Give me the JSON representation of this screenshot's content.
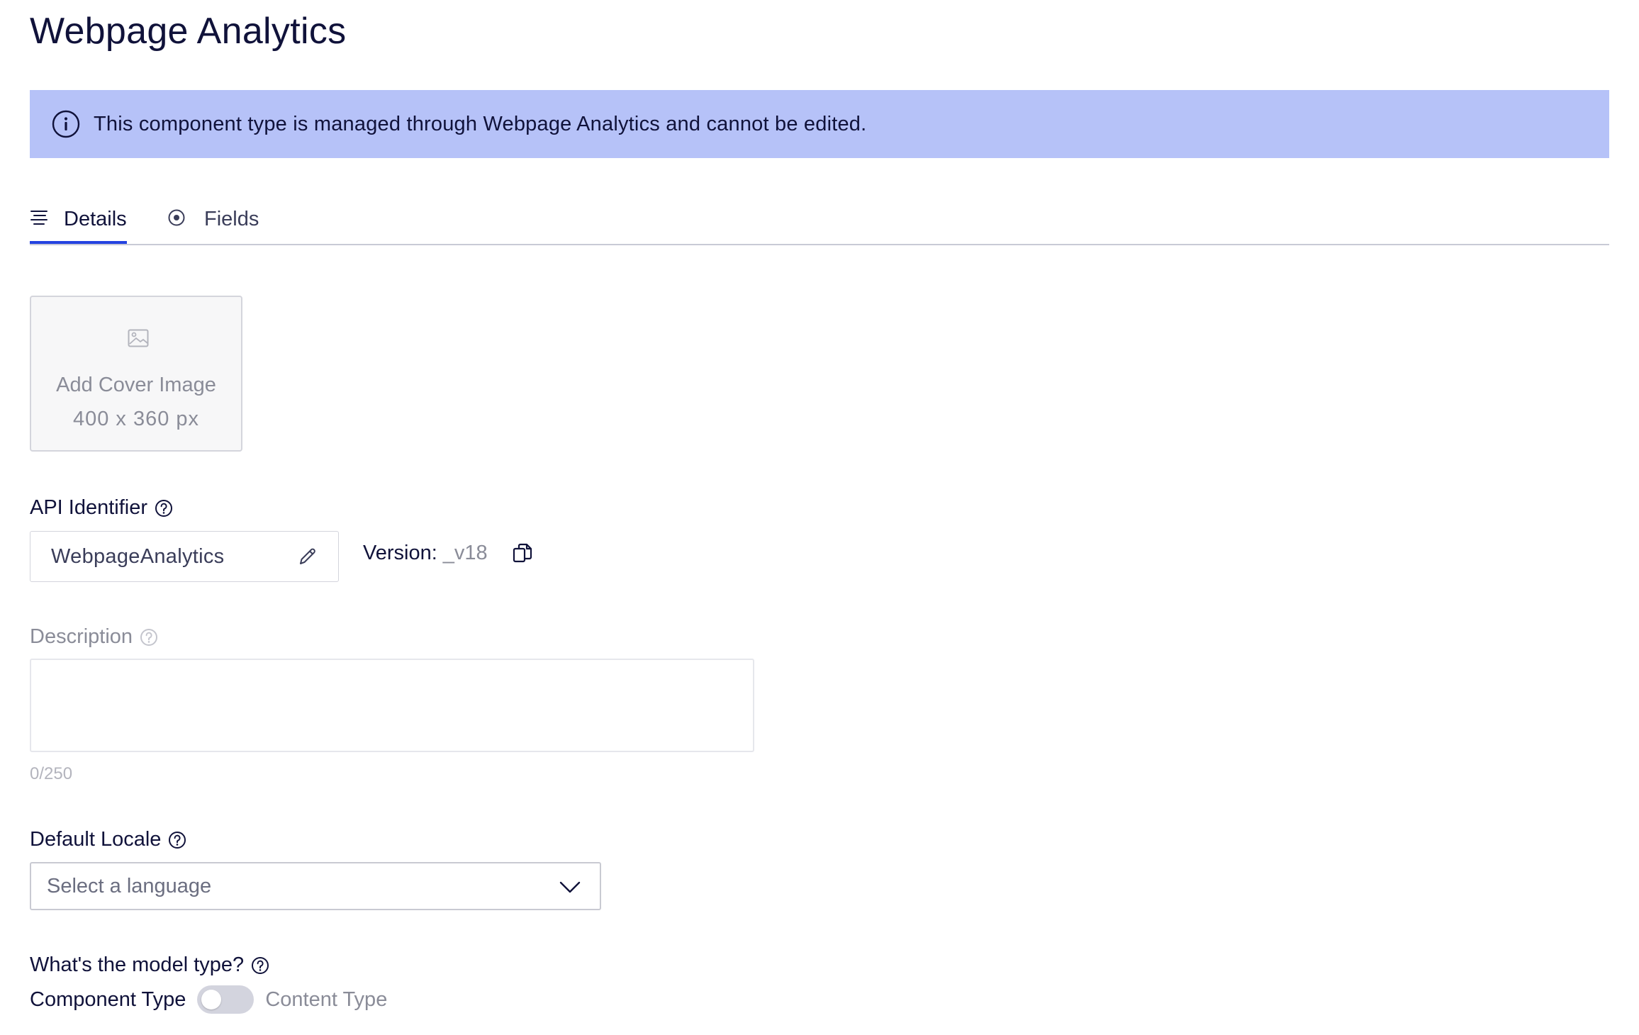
{
  "page": {
    "title": "Webpage Analytics"
  },
  "banner": {
    "text": "This component type is managed through Webpage Analytics and cannot be edited.",
    "icon": "info-icon",
    "color": "#b6c2f8"
  },
  "tabs": [
    {
      "label": "Details",
      "icon": "list-icon",
      "active": true
    },
    {
      "label": "Fields",
      "icon": "radio-icon",
      "active": false
    }
  ],
  "cover_image": {
    "title": "Add Cover Image",
    "dimensions": "400 x 360 px",
    "icon": "image-icon"
  },
  "api_identifier": {
    "label": "API Identifier",
    "value": "WebpageAnalytics",
    "version_label": "Version:",
    "version_value": "_v18"
  },
  "description": {
    "label": "Description",
    "value": "",
    "counter": "0/250"
  },
  "default_locale": {
    "label": "Default Locale",
    "placeholder": "Select a language"
  },
  "model_type": {
    "label": "What's the model type?",
    "option_off": "Component Type",
    "option_on": "Content Type",
    "enabled": false
  },
  "colors": {
    "accent": "#2342e0",
    "text": "#10123a",
    "muted": "#8a8c98"
  }
}
